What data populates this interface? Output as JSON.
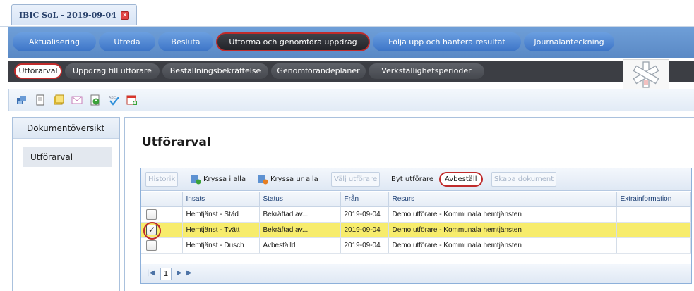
{
  "window": {
    "tab_title": "IBIC SoL - 2019-09-04"
  },
  "main_nav": [
    "Aktualisering",
    "Utreda",
    "Besluta",
    "Utforma och genomföra uppdrag",
    "Följa upp och hantera resultat",
    "Journalanteckning"
  ],
  "sub_nav": [
    "Utförarval",
    "Uppdrag till utförare",
    "Beställningsbekräftelse",
    "Genomförandeplaner",
    "Verkställighetsperioder"
  ],
  "toolbar_icons": [
    "puzzle-icon",
    "document-icon",
    "notes-icon",
    "envelope-icon",
    "refresh-icon",
    "spellcheck-icon",
    "calendar-add-icon"
  ],
  "sidebar": {
    "header": "Dokumentöversikt",
    "item": "Utförarval"
  },
  "page": {
    "title": "Utförarval"
  },
  "grid": {
    "buttons": {
      "historik": "Historik",
      "kryssa_i_alla": "Kryssa i alla",
      "kryssa_ur_alla": "Kryssa ur alla",
      "valj_utforare": "Välj utförare",
      "byt_utforare": "Byt utförare",
      "avbestall": "Avbeställ",
      "skapa_dokument": "Skapa dokument"
    },
    "columns": [
      "Insats",
      "Status",
      "Från",
      "Resurs",
      "Extrainformation"
    ],
    "rows": [
      {
        "checked": false,
        "insats": "Hemtjänst - Städ",
        "status": "Bekräftad av...",
        "fran": "2019-09-04",
        "resurs": "Demo utförare - Kommunala hemtjänsten",
        "extra": ""
      },
      {
        "checked": true,
        "insats": "Hemtjänst - Tvätt",
        "status": "Bekräftad av...",
        "fran": "2019-09-04",
        "resurs": "Demo utförare - Kommunala hemtjänsten",
        "extra": ""
      },
      {
        "checked": false,
        "insats": "Hemtjänst - Dusch",
        "status": "Avbeställd",
        "fran": "2019-09-04",
        "resurs": "Demo utförare - Kommunala hemtjänsten",
        "extra": ""
      }
    ],
    "pager": {
      "page": "1"
    }
  },
  "colors": {
    "accent": "#5a89c5",
    "highlight_row": "#f7ec6c",
    "annotation": "#c02b2b",
    "dark_nav": "#3c3e44"
  }
}
